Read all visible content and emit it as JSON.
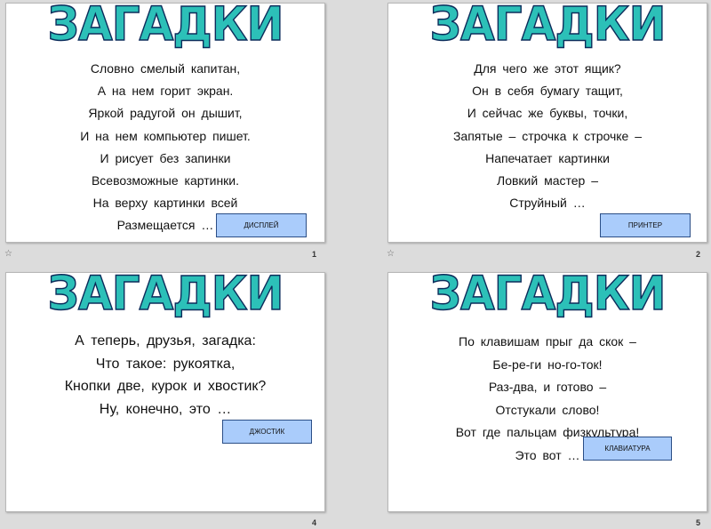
{
  "slides": [
    {
      "title": "ЗАГАДКИ",
      "lines": [
        "Словно смелый капитан,",
        "А на нем горит экран.",
        "Яркой радугой он дышит,",
        "И на нем компьютер пишет.",
        "И рисует без запинки",
        "Всевозможные картинки.",
        "На верху картинки всей",
        "Размещается …"
      ],
      "answer": "дисплей",
      "number": "1"
    },
    {
      "title": "ЗАГАДКИ",
      "lines": [
        "Для чего же этот ящик?",
        "Он в себя бумагу тащит,",
        "И сейчас же буквы, точки,",
        "Запятые – строчка к строчке –",
        "Напечатает картинки",
        "Ловкий мастер –",
        "Струйный …"
      ],
      "answer": "принтер",
      "number": "2"
    },
    {
      "title": "ЗАГАДКИ",
      "lines": [
        "А теперь, друзья, загадка:",
        "Что такое: рукоятка,",
        "Кнопки две, курок и хвостик?",
        "Ну, конечно, это …"
      ],
      "answer": "джостик",
      "number": "4"
    },
    {
      "title": "ЗАГАДКИ",
      "lines": [
        "По клавишам прыг да скок –",
        "Бе-ре-ги но-го-ток!",
        "Раз-два, и готово –",
        "Отстукали слово!",
        "Вот где пальцам физкультура!",
        "Это вот …"
      ],
      "answer": "клавиатура",
      "number": "5"
    }
  ],
  "transition_icon": "star-transition-icon",
  "colors": {
    "title_fill": "#2cc0b8",
    "title_outline": "#0c2b5a",
    "answer_fill": "#aaccfb",
    "answer_border": "#2b4e86",
    "background": "#dcdcdc"
  }
}
